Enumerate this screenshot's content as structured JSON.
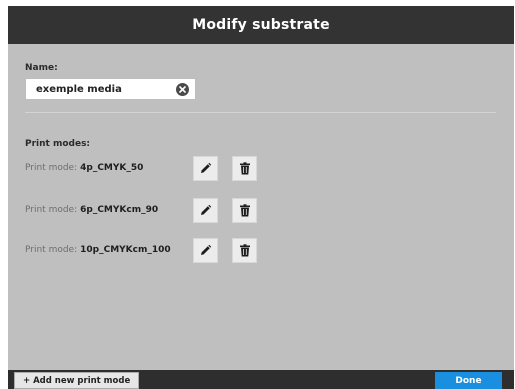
{
  "dialog": {
    "title": "Modify substrate"
  },
  "name_field": {
    "label": "Name:",
    "value": "exemple media"
  },
  "print_modes": {
    "heading": "Print modes:",
    "caption": "Print mode:",
    "items": [
      {
        "name": "4p_CMYK_50"
      },
      {
        "name": "6p_CMYKcm_90"
      },
      {
        "name": "10p_CMYKcm_100"
      }
    ]
  },
  "icons": {
    "clear": "clear-icon",
    "edit": "pencil-icon",
    "delete": "trash-icon"
  },
  "footer": {
    "add_label": "+ Add new print mode",
    "done_label": "Done"
  },
  "colors": {
    "titlebar": "#333333",
    "background": "#bfbfbf",
    "accent": "#1a8fe0"
  }
}
